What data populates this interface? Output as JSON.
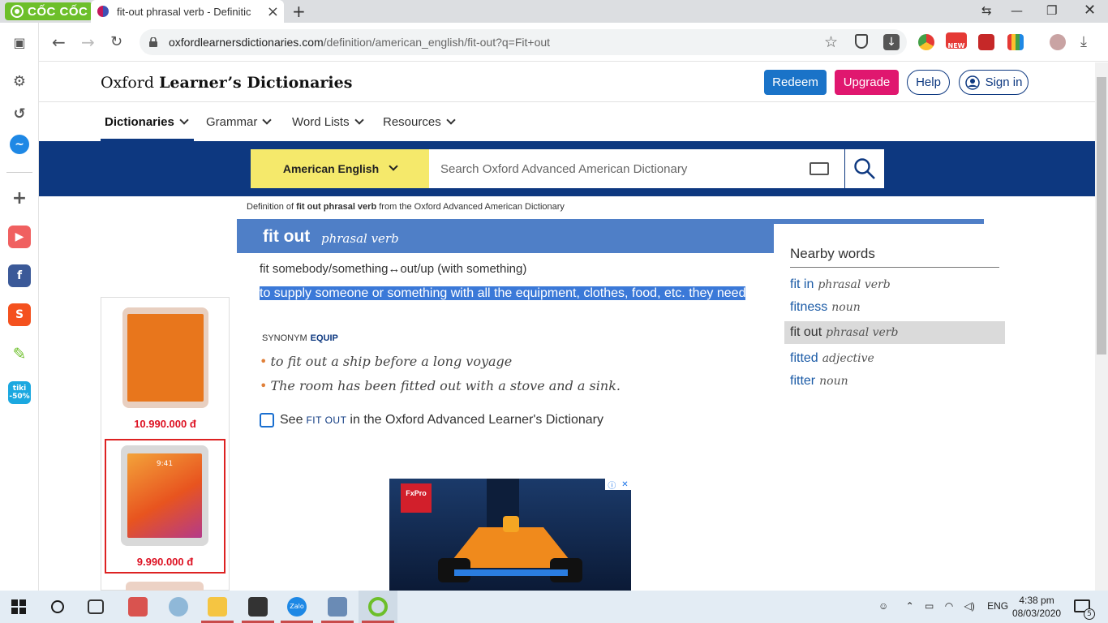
{
  "browser": {
    "brand": "CỐC CỐC",
    "tab_title": "fit-out phrasal verb - Definitic",
    "url_host": "oxfordlearnersdictionaries.com",
    "url_path": "/definition/american_english/fit-out?q=Fit+out",
    "new_badge": "NEW",
    "tiki_label": "tiki",
    "tiki_discount": "-50%"
  },
  "site": {
    "brand_oxford": "Oxford",
    "brand_rest": "Learner’s Dictionaries",
    "buttons": {
      "redeem": "Redeem",
      "upgrade": "Upgrade",
      "help": "Help",
      "signin": "Sign in"
    },
    "nav": [
      "Dictionaries",
      "Grammar",
      "Word Lists",
      "Resources"
    ],
    "dict_select": "American English",
    "search_placeholder": "Search Oxford Advanced American Dictionary"
  },
  "entry": {
    "defof_pre": "Definition of",
    "defof_word": "fit out phrasal verb",
    "defof_post": "from the Oxford Advanced American Dictionary",
    "headword": "fit out",
    "pos": "phrasal verb",
    "cf": "fit somebody/something↔out/up (with something)",
    "definition": "to supply someone or something with all the equipment, clothes, food, etc. they need",
    "synonym_label": "SYNONYM",
    "synonym": "EQUIP",
    "examples": [
      "to fit out a ship before a long voyage",
      "The room has been fitted out with a stove and a sink."
    ],
    "see_pre": "See",
    "see_word": "FIT OUT",
    "see_post": "in the Oxford Advanced Learner's Dictionary"
  },
  "nearby": {
    "title": "Nearby words",
    "items": [
      {
        "word": "fit in",
        "pos": "phrasal verb"
      },
      {
        "word": "fitness",
        "pos": "noun"
      },
      {
        "word": "fit out",
        "pos": "phrasal verb"
      },
      {
        "word": "fitted",
        "pos": "adjective"
      },
      {
        "word": "fitter",
        "pos": "noun"
      }
    ],
    "selected_index": 2
  },
  "ads": {
    "prices": [
      "10.990.000 đ",
      "9.990.000 đ"
    ],
    "tablet_time": "9:41",
    "banner_brand": "FxPro"
  },
  "taskbar": {
    "language": "ENG",
    "time": "4:38 pm",
    "date": "08/03/2020",
    "zalo": "Zalo",
    "notifications": "5"
  }
}
